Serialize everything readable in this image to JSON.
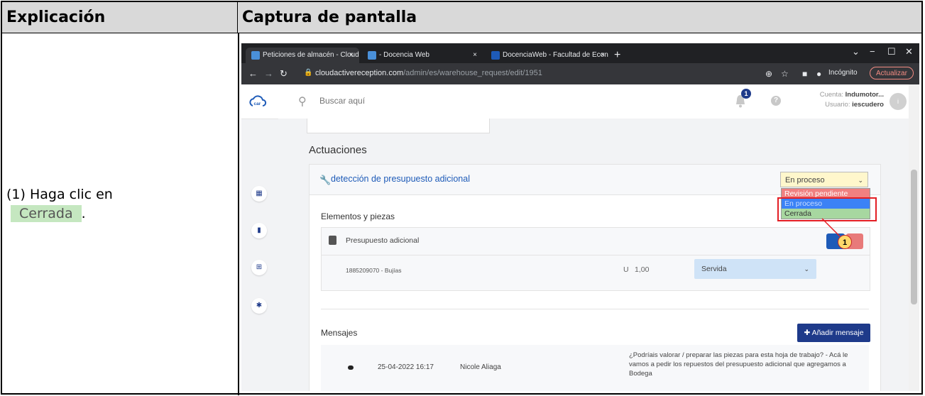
{
  "doc": {
    "header_left": "Explicación",
    "header_right": "Captura de pantalla",
    "instruction_prefix": "(1) Haga clic en",
    "instruction_target": "Cerrada",
    "instruction_suffix": "."
  },
  "browser": {
    "tabs": [
      {
        "label": "Peticiones de almacén - Cloud A",
        "close": "×"
      },
      {
        "label": "- Docencia Web",
        "close": "×"
      },
      {
        "label": "DocenciaWeb - Facultad de Econ",
        "close": "×"
      }
    ],
    "new_tab": "+",
    "url_host": "cloudactivereception.com",
    "url_path": "/admin/es/warehouse_request/edit/1951",
    "incognito_label": "Incógnito",
    "update_label": "Actualizar"
  },
  "app": {
    "search_placeholder": "Buscar aquí",
    "notification_count": "1",
    "account_label": "Cuenta:",
    "account_value": "Indumotor...",
    "user_label": "Usuario:",
    "user_value": "iescudero",
    "logo_text": "car"
  },
  "main": {
    "section_title": "Actuaciones",
    "actuation_title": "detección de presupuesto adicional",
    "status_selected": "En proceso",
    "status_options": [
      "Revisión pendiente",
      "En proceso",
      "Cerrada"
    ],
    "items_title": "Elementos y piezas",
    "piece_title": "Presupuesto adicional",
    "piece_ref": "1885209070 - Bujías",
    "unit_label": "U",
    "quantity": "1,00",
    "piece_status": "Servida",
    "callout_number": "1",
    "messages_title": "Mensajes",
    "add_message": "Añadir mensaje",
    "message": {
      "date": "25-04-2022 16:17",
      "author": "Nicole Aliaga",
      "text": "¿Podríais valorar / preparar las piezas para esta hoja de trabajo? - Acá le vamos a pedir los repuestos del presupuesto adicional que agregamos a Bodega"
    }
  },
  "colors": {
    "highlight_green": "#c5e7c0",
    "brand_navy": "#1e3a8a",
    "callout_red": "#e31e24"
  }
}
